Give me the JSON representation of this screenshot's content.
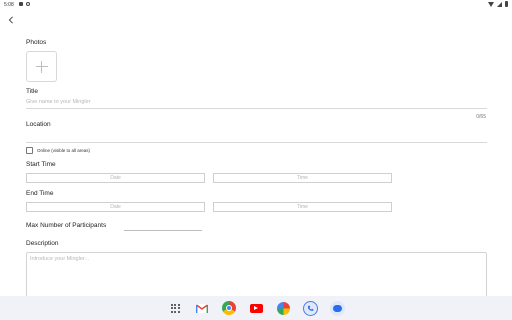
{
  "status_bar": {
    "time": "5:08"
  },
  "form": {
    "photos_label": "Photos",
    "title_label": "Title",
    "title_placeholder": "Give name to your Mingler",
    "title_counter": "0/65",
    "location_label": "Location",
    "location_value": "",
    "online_label": "Online (visible to all areas)",
    "online_checked": false,
    "start_time_label": "Start Time",
    "start_date_placeholder": "Date",
    "start_time_placeholder": "Time",
    "end_time_label": "End Time",
    "end_date_placeholder": "Date",
    "end_time_placeholder": "Time",
    "max_participants_label": "Max Number of Participants",
    "max_participants_value": "",
    "description_label": "Description",
    "description_placeholder": "Introduce your Mingler..."
  },
  "dock": {
    "apps": [
      "app-drawer-icon",
      "gmail-icon",
      "chrome-icon",
      "youtube-icon",
      "photos-icon",
      "phone-icon",
      "messages-icon"
    ]
  }
}
